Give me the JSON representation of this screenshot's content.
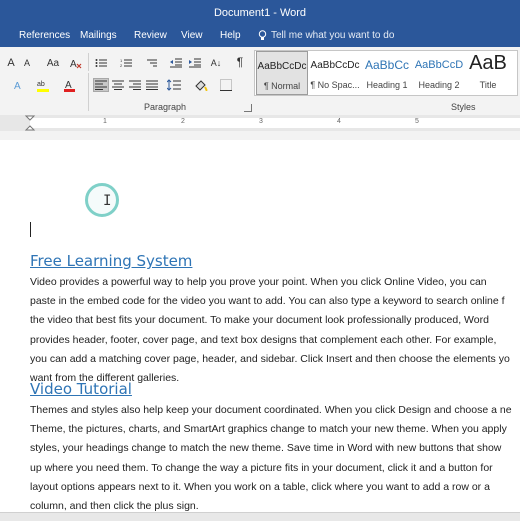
{
  "window": {
    "title": "Document1 - Word"
  },
  "menu": {
    "tabs": [
      "References",
      "Mailings",
      "Review",
      "View",
      "Help"
    ],
    "tell_me": "Tell me what you want to do"
  },
  "ribbon": {
    "paragraph_label": "Paragraph",
    "styles_label": "Styles",
    "styles": [
      {
        "sample": "AaBbCcDc",
        "name": "¶ Normal"
      },
      {
        "sample": "AaBbCcDc",
        "name": "¶ No Spac..."
      },
      {
        "sample": "AaBbCc",
        "name": "Heading 1"
      },
      {
        "sample": "AaBbCcD",
        "name": "Heading 2"
      },
      {
        "sample": "AaB",
        "name": "Title"
      }
    ],
    "icons": {
      "font_grow": "A",
      "font_color": "A",
      "show_marks": "¶",
      "sort": "A↓"
    }
  },
  "ruler": {
    "numbers": [
      "1",
      "2",
      "3",
      "4",
      "5"
    ]
  },
  "document": {
    "heading1": "Free Learning System",
    "para1": [
      "Video provides a powerful way to help you prove your point. When you click Online Video, you can",
      "paste in the embed code for the video you want to add. You can also type a keyword to search online f",
      "the video that best fits your document. To make your document look professionally produced, Word",
      "provides header, footer, cover page, and text box designs that complement each other. For example,",
      "you can add a matching cover page, header, and sidebar. Click Insert and then choose the elements yo",
      "want from the different galleries."
    ],
    "heading2": "Video Tutorial",
    "para2": [
      "Themes and styles also help keep your document coordinated. When you click Design and choose a ne",
      "Theme, the pictures, charts, and SmartArt graphics change to match your new theme. When you apply",
      "styles, your headings change to match the new theme. Save time in Word with new buttons that show",
      "up where you need them. To change the way a picture fits in your document, click it and a button for",
      "layout options appears next to it. When you work on a table, click where you want to add a row or a",
      "column, and then click the plus sign."
    ]
  },
  "colors": {
    "accent": "#2b579a",
    "heading": "#2e74b5"
  }
}
